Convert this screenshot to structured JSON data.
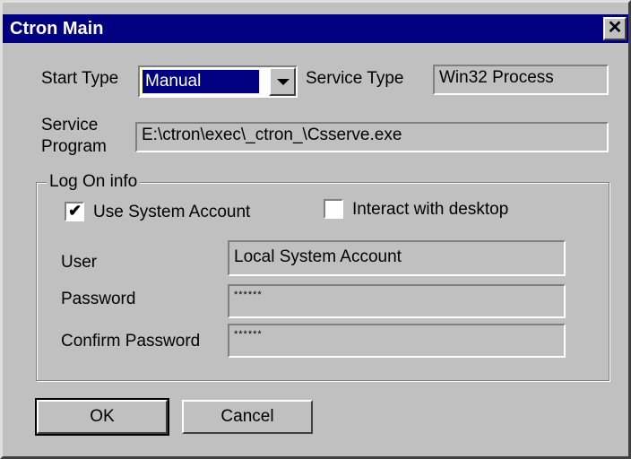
{
  "window": {
    "title": "Ctron Main",
    "close_glyph": "✕"
  },
  "service": {
    "start_type_label": "Start Type",
    "start_type_value": "Manual",
    "service_type_label": "Service Type",
    "service_type_value": "Win32 Process",
    "program_label_line1": "Service",
    "program_label_line2": "Program",
    "program_value": "E:\\ctron\\exec\\_ctron_\\Csserve.exe"
  },
  "logon": {
    "group_label": "Log On info",
    "use_system_account_label": "Use System Account",
    "use_system_account_checked": true,
    "interact_desktop_label": "Interact with desktop",
    "interact_desktop_checked": false,
    "check_glyph": "✔",
    "user_label": "User",
    "user_value": "Local System Account",
    "password_label": "Password",
    "password_value": "******",
    "confirm_password_label": "Confirm Password",
    "confirm_password_value": "******"
  },
  "buttons": {
    "ok_label": "OK",
    "cancel_label": "Cancel"
  }
}
